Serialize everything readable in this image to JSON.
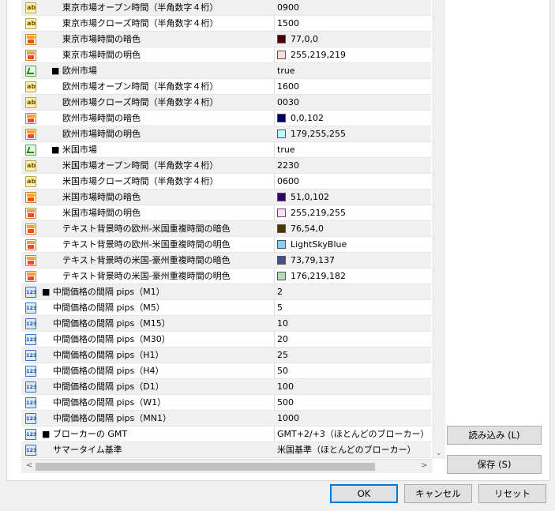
{
  "rows": [
    {
      "icon": "ab",
      "indent": 52,
      "name": "東京市場オープン時間（半角数字４桁）",
      "value": "0900",
      "swatch": null,
      "alt": true
    },
    {
      "icon": "ab",
      "indent": 52,
      "name": "東京市場クローズ時間（半角数字４桁）",
      "value": "1500",
      "swatch": null,
      "alt": false
    },
    {
      "icon": "color",
      "indent": 52,
      "name": "東京市場時間の暗色",
      "value": "77,0,0",
      "swatch": "#4d0000",
      "alt": true
    },
    {
      "icon": "color",
      "indent": 52,
      "name": "東京市場時間の明色",
      "value": "255,219,219",
      "swatch": "#ffdbdb",
      "alt": false
    },
    {
      "icon": "bool",
      "indent": 38,
      "name": "■ 欧州市場",
      "value": "true",
      "swatch": null,
      "alt": true
    },
    {
      "icon": "ab",
      "indent": 52,
      "name": "欧州市場オープン時間（半角数字４桁）",
      "value": "1600",
      "swatch": null,
      "alt": false
    },
    {
      "icon": "ab",
      "indent": 52,
      "name": "欧州市場クローズ時間（半角数字４桁）",
      "value": "0030",
      "swatch": null,
      "alt": true
    },
    {
      "icon": "color",
      "indent": 52,
      "name": "欧州市場時間の暗色",
      "value": "0,0,102",
      "swatch": "#000066",
      "alt": false
    },
    {
      "icon": "color",
      "indent": 52,
      "name": "欧州市場時間の明色",
      "value": "179,255,255",
      "swatch": "#b3ffff",
      "alt": true
    },
    {
      "icon": "bool",
      "indent": 38,
      "name": "■ 米国市場",
      "value": "true",
      "swatch": null,
      "alt": false
    },
    {
      "icon": "ab",
      "indent": 52,
      "name": "米国市場オープン時間（半角数字４桁）",
      "value": "2230",
      "swatch": null,
      "alt": true
    },
    {
      "icon": "ab",
      "indent": 52,
      "name": "米国市場クローズ時間（半角数字４桁）",
      "value": "0600",
      "swatch": null,
      "alt": false
    },
    {
      "icon": "color",
      "indent": 52,
      "name": "米国市場時間の暗色",
      "value": "51,0,102",
      "swatch": "#330066",
      "alt": true
    },
    {
      "icon": "color",
      "indent": 52,
      "name": "米国市場時間の明色",
      "value": "255,219,255",
      "swatch": "#ffdbff",
      "alt": false
    },
    {
      "icon": "color",
      "indent": 52,
      "name": "テキスト背景時の欧州-米国重複時間の暗色",
      "value": "76,54,0",
      "swatch": "#4c3600",
      "alt": true
    },
    {
      "icon": "color",
      "indent": 52,
      "name": "テキスト背景時の欧州-米国重複時間の明色",
      "value": "LightSkyBlue",
      "swatch": "#87cefa",
      "alt": false
    },
    {
      "icon": "color",
      "indent": 52,
      "name": "テキスト背景時の米国-豪州重複時間の暗色",
      "value": "73,79,137",
      "swatch": "#494f89",
      "alt": true
    },
    {
      "icon": "color",
      "indent": 52,
      "name": "テキスト背景時の米国-豪州重複時間の明色",
      "value": "176,219,182",
      "swatch": "#b0dbb6",
      "alt": false
    },
    {
      "icon": "num",
      "indent": 26,
      "name": "■ 中間価格の間隔 pips（M1）",
      "value": "2",
      "swatch": null,
      "alt": true
    },
    {
      "icon": "num",
      "indent": 40,
      "name": "中間価格の間隔 pips（M5）",
      "value": "5",
      "swatch": null,
      "alt": false
    },
    {
      "icon": "num",
      "indent": 40,
      "name": "中間価格の間隔 pips（M15）",
      "value": "10",
      "swatch": null,
      "alt": true
    },
    {
      "icon": "num",
      "indent": 40,
      "name": "中間価格の間隔 pips（M30）",
      "value": "20",
      "swatch": null,
      "alt": false
    },
    {
      "icon": "num",
      "indent": 40,
      "name": "中間価格の間隔 pips（H1）",
      "value": "25",
      "swatch": null,
      "alt": true
    },
    {
      "icon": "num",
      "indent": 40,
      "name": "中間価格の間隔 pips（H4）",
      "value": "50",
      "swatch": null,
      "alt": false
    },
    {
      "icon": "num",
      "indent": 40,
      "name": "中間価格の間隔 pips（D1）",
      "value": "100",
      "swatch": null,
      "alt": true
    },
    {
      "icon": "num",
      "indent": 40,
      "name": "中間価格の間隔 pips（W1）",
      "value": "500",
      "swatch": null,
      "alt": false
    },
    {
      "icon": "num",
      "indent": 40,
      "name": "中間価格の間隔 pips（MN1）",
      "value": "1000",
      "swatch": null,
      "alt": true
    },
    {
      "icon": "num",
      "indent": 26,
      "name": "■ ブローカーの GMT",
      "value": "GMT+2/+3（ほとんどのブローカー）",
      "swatch": null,
      "alt": false
    },
    {
      "icon": "num",
      "indent": 40,
      "name": "サマータイム基準",
      "value": "米国基準（ほとんどのブローカー）",
      "swatch": null,
      "alt": true
    }
  ],
  "buttons": {
    "load": "読み込み (L)",
    "save": "保存 (S)",
    "ok": "OK",
    "cancel": "キャンセル",
    "reset": "リセット"
  },
  "scroll": {
    "down_arrow": "⌄",
    "left_arrow": "<",
    "right_arrow": ">"
  }
}
